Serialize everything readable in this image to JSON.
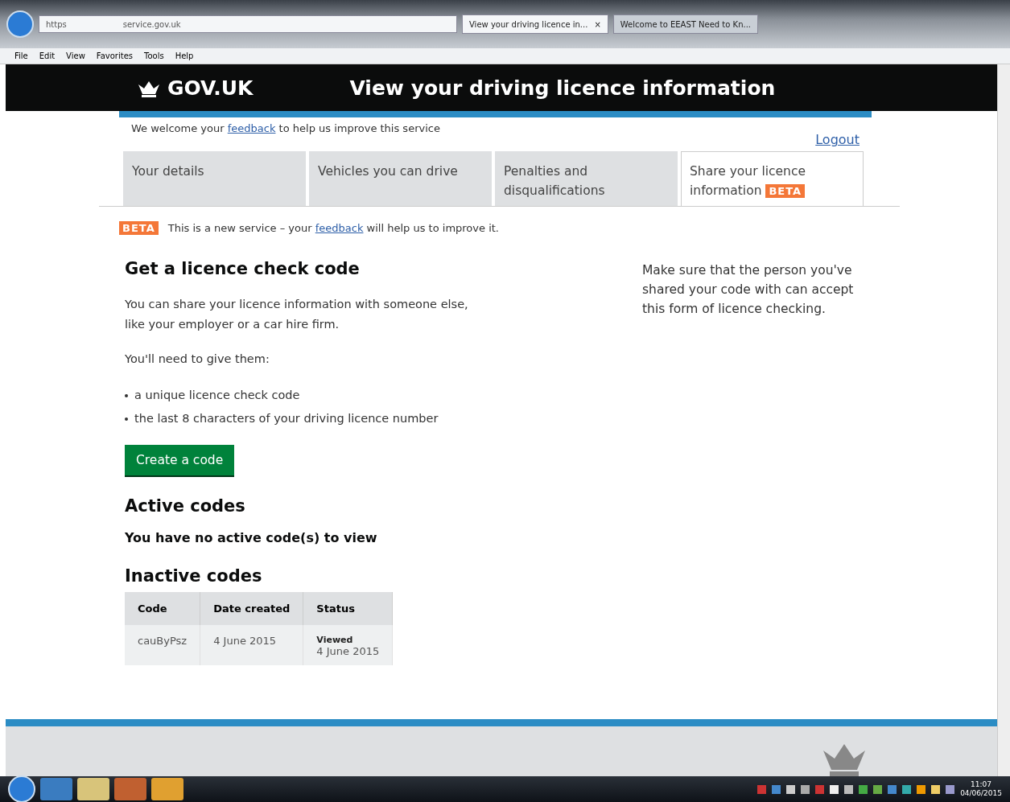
{
  "browser": {
    "address": [
      "https",
      "service.gov.uk"
    ],
    "tabs": [
      {
        "label": "View your driving licence in...",
        "selected": true,
        "close": "×"
      },
      {
        "label": "Welcome to EEAST Need to Kn...",
        "selected": false
      }
    ],
    "menu": [
      "File",
      "Edit",
      "View",
      "Favorites",
      "Tools",
      "Help"
    ]
  },
  "header": {
    "logo": "GOV.UK",
    "title": "View your driving licence information"
  },
  "feedback_bar": {
    "before": "We welcome your",
    "link": "feedback",
    "after": "to help us improve this service",
    "logout": "Logout"
  },
  "tabs": [
    {
      "label": "Your details",
      "selected": false
    },
    {
      "label": "Vehicles you can drive",
      "selected": false
    },
    {
      "label": "Penalties and disqualifications",
      "selected": false
    },
    {
      "label": "Share your licence information",
      "badge": "BETA",
      "selected": true
    }
  ],
  "beta_banner": {
    "badge": "BETA",
    "before": "This is a new service – your",
    "link": "feedback",
    "after": "will help us to improve it."
  },
  "main": {
    "heading": "Get a licence check code",
    "intro": "You can share your licence information with someone else, like your employer or a car hire firm.",
    "need": "You'll need to give them:",
    "bullets": [
      "a unique licence check code",
      "the last 8 characters of your driving licence number"
    ],
    "button": "Create a code",
    "active_heading": "Active codes",
    "active_text": "You have no active code(s) to view",
    "inactive_heading": "Inactive codes"
  },
  "aside": "Make sure that the person you've shared your code with can accept this form of licence checking.",
  "table": {
    "columns": [
      "Code",
      "Date created",
      "Status"
    ],
    "rows": [
      {
        "code": "cauByPsz",
        "date": "4 June 2015",
        "status": "Viewed",
        "status_date": "4 June 2015"
      }
    ]
  },
  "taskbar": {
    "time": "11:07",
    "date": "04/06/2015"
  }
}
